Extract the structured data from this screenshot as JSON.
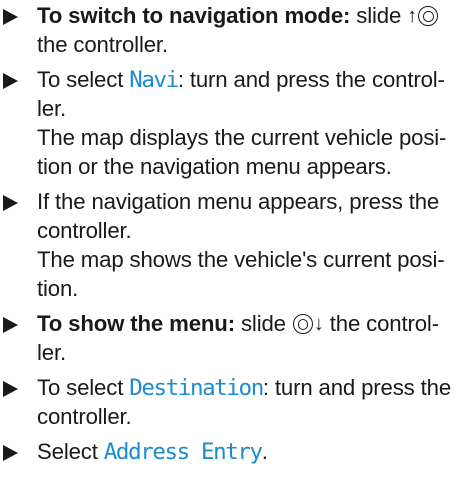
{
  "steps": [
    {
      "lines": [
        {
          "prefix_bold": "To switch to navigation mode:",
          "text_a": " slide ",
          "icon": "slide-up-controller-icon",
          "text_b": ""
        },
        {
          "text": "the controller."
        }
      ]
    },
    {
      "lines": [
        {
          "text_a": "To select ",
          "display": "Navi",
          "text_b": ": turn and press the control-"
        },
        {
          "text": "ler."
        },
        {
          "text": "The map displays the current vehicle posi-"
        },
        {
          "text": "tion or the navigation menu appears."
        }
      ]
    },
    {
      "lines": [
        {
          "text": "If the navigation menu appears, press the"
        },
        {
          "text": "controller."
        },
        {
          "text": "The map shows the vehicle's current posi-"
        },
        {
          "text": "tion."
        }
      ]
    },
    {
      "lines": [
        {
          "prefix_bold": "To show the menu:",
          "text_a": " slide ",
          "icon": "slide-down-controller-icon",
          "text_b": " the control-"
        },
        {
          "text": "ler."
        }
      ]
    },
    {
      "lines": [
        {
          "text_a": "To select ",
          "display": "Destination",
          "text_b": ": turn and press the"
        },
        {
          "text": "controller."
        }
      ]
    },
    {
      "lines": [
        {
          "text_a": "Select ",
          "display": "Address Entry",
          "text_b": "."
        }
      ]
    }
  ],
  "colors": {
    "text": "#1a1a1a",
    "display_text": "#1e8ccc"
  },
  "icons": {
    "bullet": "right-triangle-bullet-icon",
    "slide_up": "slide-up-controller-icon",
    "slide_down": "slide-down-controller-icon"
  }
}
